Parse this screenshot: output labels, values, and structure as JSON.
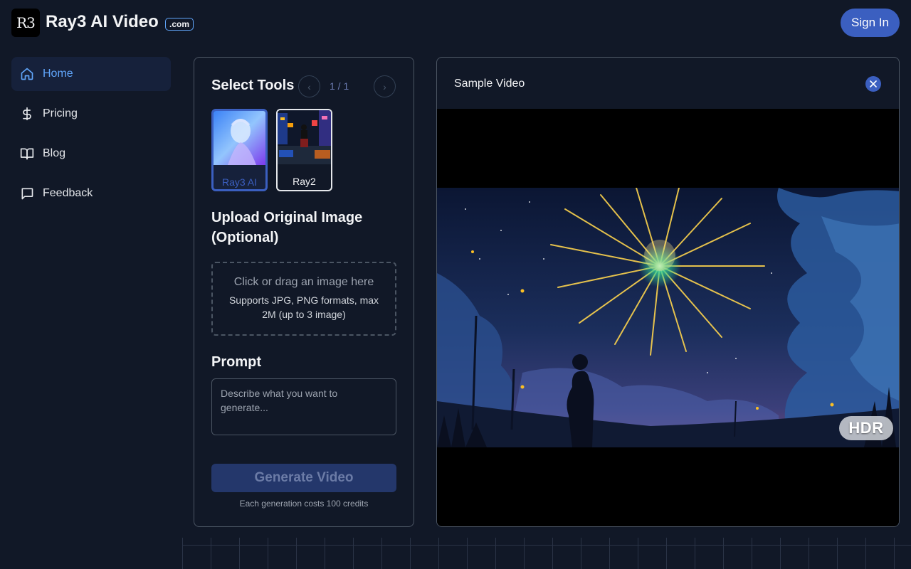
{
  "brand": {
    "logo_text": "R3",
    "name": "Ray3 AI Video",
    "badge": ".com"
  },
  "header": {
    "signin_label": "Sign In"
  },
  "sidebar": {
    "items": [
      {
        "label": "Home",
        "icon": "home-icon",
        "active": true
      },
      {
        "label": "Pricing",
        "icon": "dollar-icon",
        "active": false
      },
      {
        "label": "Blog",
        "icon": "book-icon",
        "active": false
      },
      {
        "label": "Feedback",
        "icon": "chat-icon",
        "active": false
      }
    ]
  },
  "tools": {
    "title": "Select Tools",
    "pager": "1 / 1",
    "items": [
      {
        "label": "Ray3 AI",
        "selected": true
      },
      {
        "label": "Ray2",
        "selected": false
      }
    ]
  },
  "upload": {
    "title": "Upload Original Image (Optional)",
    "main_text": "Click or drag an image here",
    "sub_text": "Supports JPG, PNG formats, max 2M (up to 3 image)"
  },
  "prompt": {
    "title": "Prompt",
    "placeholder": "Describe what you want to generate..."
  },
  "generate": {
    "button_label": "Generate Video",
    "cost_note": "Each generation costs 100 credits"
  },
  "sample": {
    "title": "Sample Video",
    "badge": "HDR"
  },
  "colors": {
    "background": "#111827",
    "accent": "#3b5fc0",
    "active_text": "#60a5fa",
    "border": "#4b5563"
  }
}
